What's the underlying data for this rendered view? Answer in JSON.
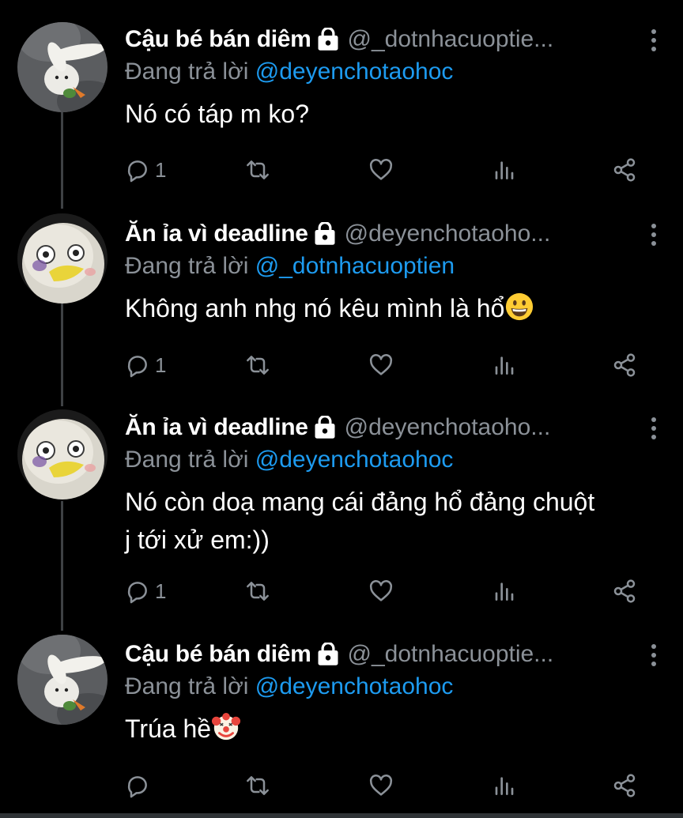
{
  "thread": {
    "tweets": [
      {
        "display_name": "Cậu bé bán diêm",
        "handle": "@_dotnhacuoptie...",
        "reply_prefix": "Đang trả lời",
        "reply_to": "@deyenchotaohoc",
        "text": "Nó có táp m ko?",
        "reply_count": "1",
        "avatar": "rabbit-avatar"
      },
      {
        "display_name": "Ăn ỉa vì deadline",
        "handle": "@deyenchotaoho...",
        "reply_prefix": "Đang trả lời",
        "reply_to": "@_dotnhacuoptien",
        "text": "Không anh nhg nó kêu mình là hổ",
        "emoji": "grinning-face-emoji",
        "reply_count": "1",
        "avatar": "duck-avatar"
      },
      {
        "display_name": "Ăn ỉa vì deadline",
        "handle": "@deyenchotaoho...",
        "reply_prefix": "Đang trả lời",
        "reply_to": "@deyenchotaohoc",
        "text_line1": "Nó còn doạ mang cái đảng hổ đảng chuột",
        "text_line2": "j tới xử em:))",
        "reply_count": "1",
        "avatar": "duck-avatar"
      },
      {
        "display_name": "Cậu bé bán diêm",
        "handle": "@_dotnhacuoptie...",
        "reply_prefix": "Đang trả lời",
        "reply_to": "@deyenchotaohoc",
        "text": "Trúa hề",
        "emoji": "clown-face-emoji",
        "reply_count": "",
        "avatar": "rabbit-avatar"
      }
    ]
  },
  "colors": {
    "background": "#000000",
    "name": "#ffffff",
    "muted": "#8b9198",
    "mention": "#1d9bf0",
    "thread_line": "#3e4144"
  },
  "icons": [
    "lock-icon",
    "more-icon",
    "reply-icon",
    "retweet-icon",
    "like-icon",
    "views-icon",
    "share-icon"
  ]
}
